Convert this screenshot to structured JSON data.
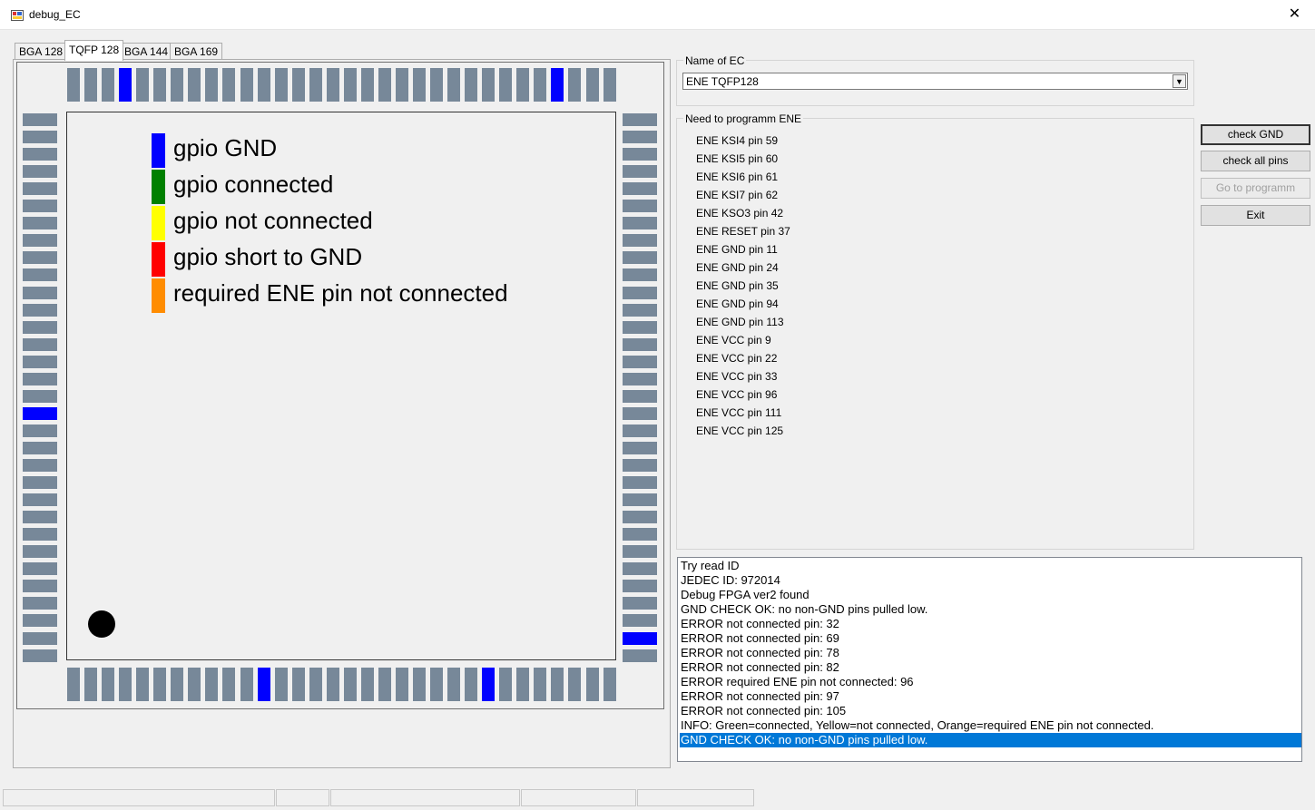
{
  "window": {
    "title": "debug_EC",
    "close_glyph": "✕"
  },
  "tabs": [
    "BGA 128",
    "TQFP 128",
    "BGA 144",
    "BGA 169"
  ],
  "active_tab": "TQFP 128",
  "colors": {
    "pin_default": "#778899",
    "pin_gnd": "#0000ff",
    "selection": "#0078d7"
  },
  "legend": [
    {
      "label": "gpio GND",
      "color": "#0000ff"
    },
    {
      "label": "gpio connected",
      "color": "#008000"
    },
    {
      "label": "gpio not connected",
      "color": "#ffff00"
    },
    {
      "label": "gpio short to GND",
      "color": "#ff0000"
    },
    {
      "label": "required ENE pin not connected",
      "color": "#ff8c00"
    }
  ],
  "pins": {
    "per_side": 32,
    "gnd_top": [
      3,
      28
    ],
    "gnd_bottom": [
      11,
      24
    ],
    "gnd_left": [
      17
    ],
    "gnd_right": [
      30
    ]
  },
  "ec_name": {
    "label": "Name of EC",
    "value": "ENE TQFP128"
  },
  "need_program": {
    "label": "Need to programm ENE",
    "items": [
      "ENE KSI4  pin 59",
      "ENE KSI5  pin 60",
      "ENE KSI6  pin 61",
      "ENE KSI7  pin 62",
      "ENE KSO3  pin 42",
      "ENE RESET pin 37",
      "ENE GND pin 11",
      "ENE GND pin 24",
      "ENE GND pin 35",
      "ENE GND pin 94",
      "ENE GND pin 113",
      "ENE VCC pin 9",
      "ENE VCC pin 22",
      "ENE VCC pin 33",
      "ENE VCC pin 96",
      "ENE VCC pin 111",
      "ENE VCC pin 125"
    ]
  },
  "buttons": {
    "check_gnd": "check GND",
    "check_all": "check all pins",
    "go_program": "Go to programm",
    "exit": "Exit"
  },
  "log": {
    "lines": [
      "Try read ID",
      "JEDEC ID: 972014",
      "Debug FPGA ver2 found",
      "GND CHECK OK: no non-GND pins pulled low.",
      "ERROR not connected pin: 32",
      "ERROR not connected pin: 69",
      "ERROR not connected pin: 78",
      "ERROR not connected pin: 82",
      "ERROR required ENE pin not connected: 96",
      "ERROR not connected pin: 97",
      "ERROR not connected pin: 105",
      "INFO: Green=connected, Yellow=not connected, Orange=required ENE pin not connected.",
      "GND CHECK OK: no non-GND pins pulled low."
    ],
    "selected_index": 12
  }
}
